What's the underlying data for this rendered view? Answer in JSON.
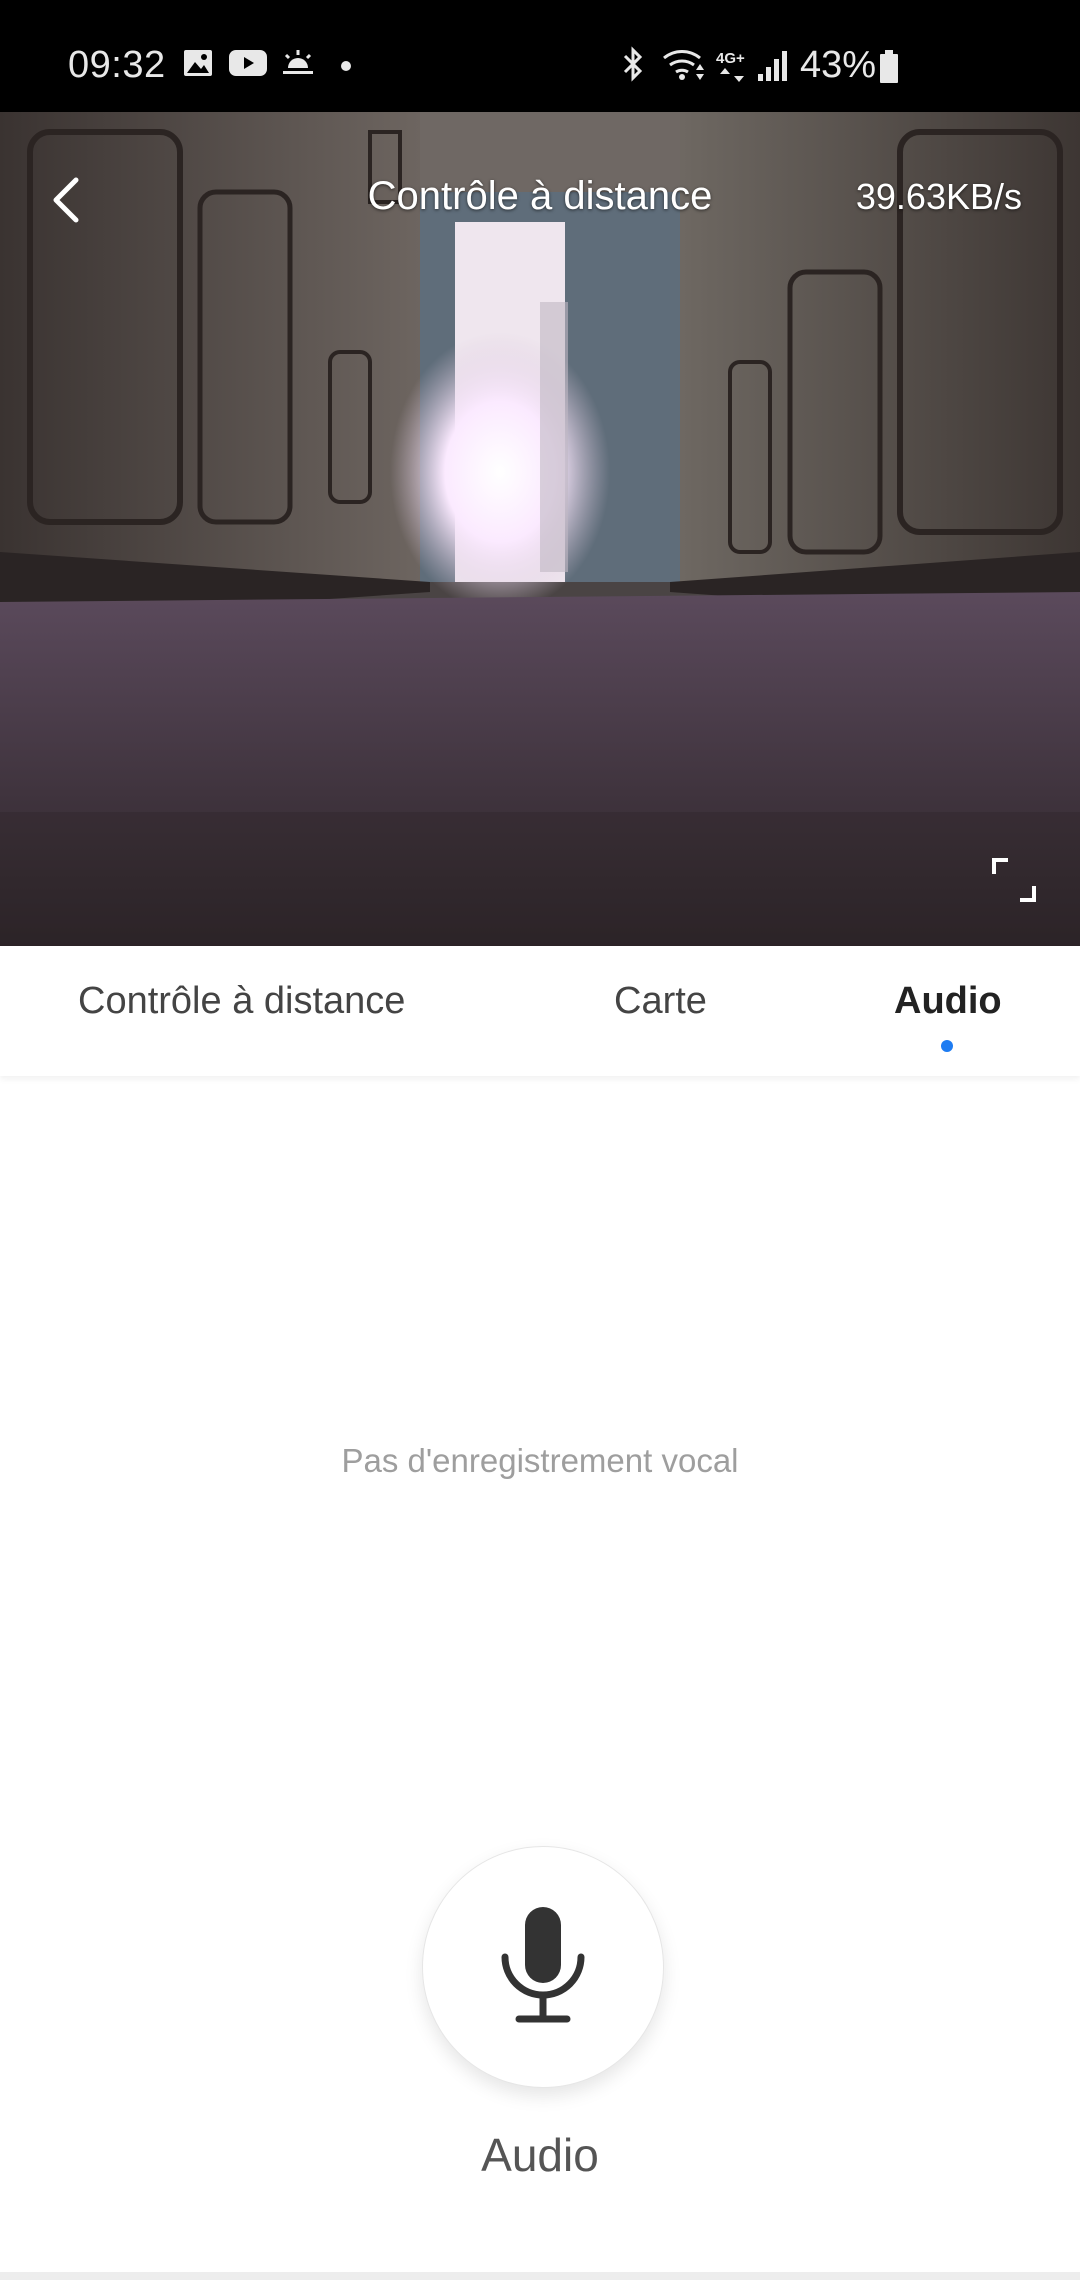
{
  "status_bar": {
    "time": "09:32",
    "network": "4G+",
    "battery": "43%",
    "icons": [
      "gallery-icon",
      "youtube-icon",
      "weather-icon",
      "dot-icon",
      "bluetooth-icon",
      "wifi-icon",
      "network-icon",
      "signal-icon",
      "battery-icon"
    ]
  },
  "camera": {
    "title": "Contrôle à distance",
    "data_rate": "39.63KB/s"
  },
  "tabs": [
    {
      "label": "Contrôle à distance",
      "active": false
    },
    {
      "label": "Carte",
      "active": false
    },
    {
      "label": "Audio",
      "active": true
    }
  ],
  "audio": {
    "empty_message": "Pas d'enregistrement vocal",
    "button_label": "Audio"
  },
  "colors": {
    "accent": "#1e7cf2",
    "status_bar_bg": "#000000"
  }
}
